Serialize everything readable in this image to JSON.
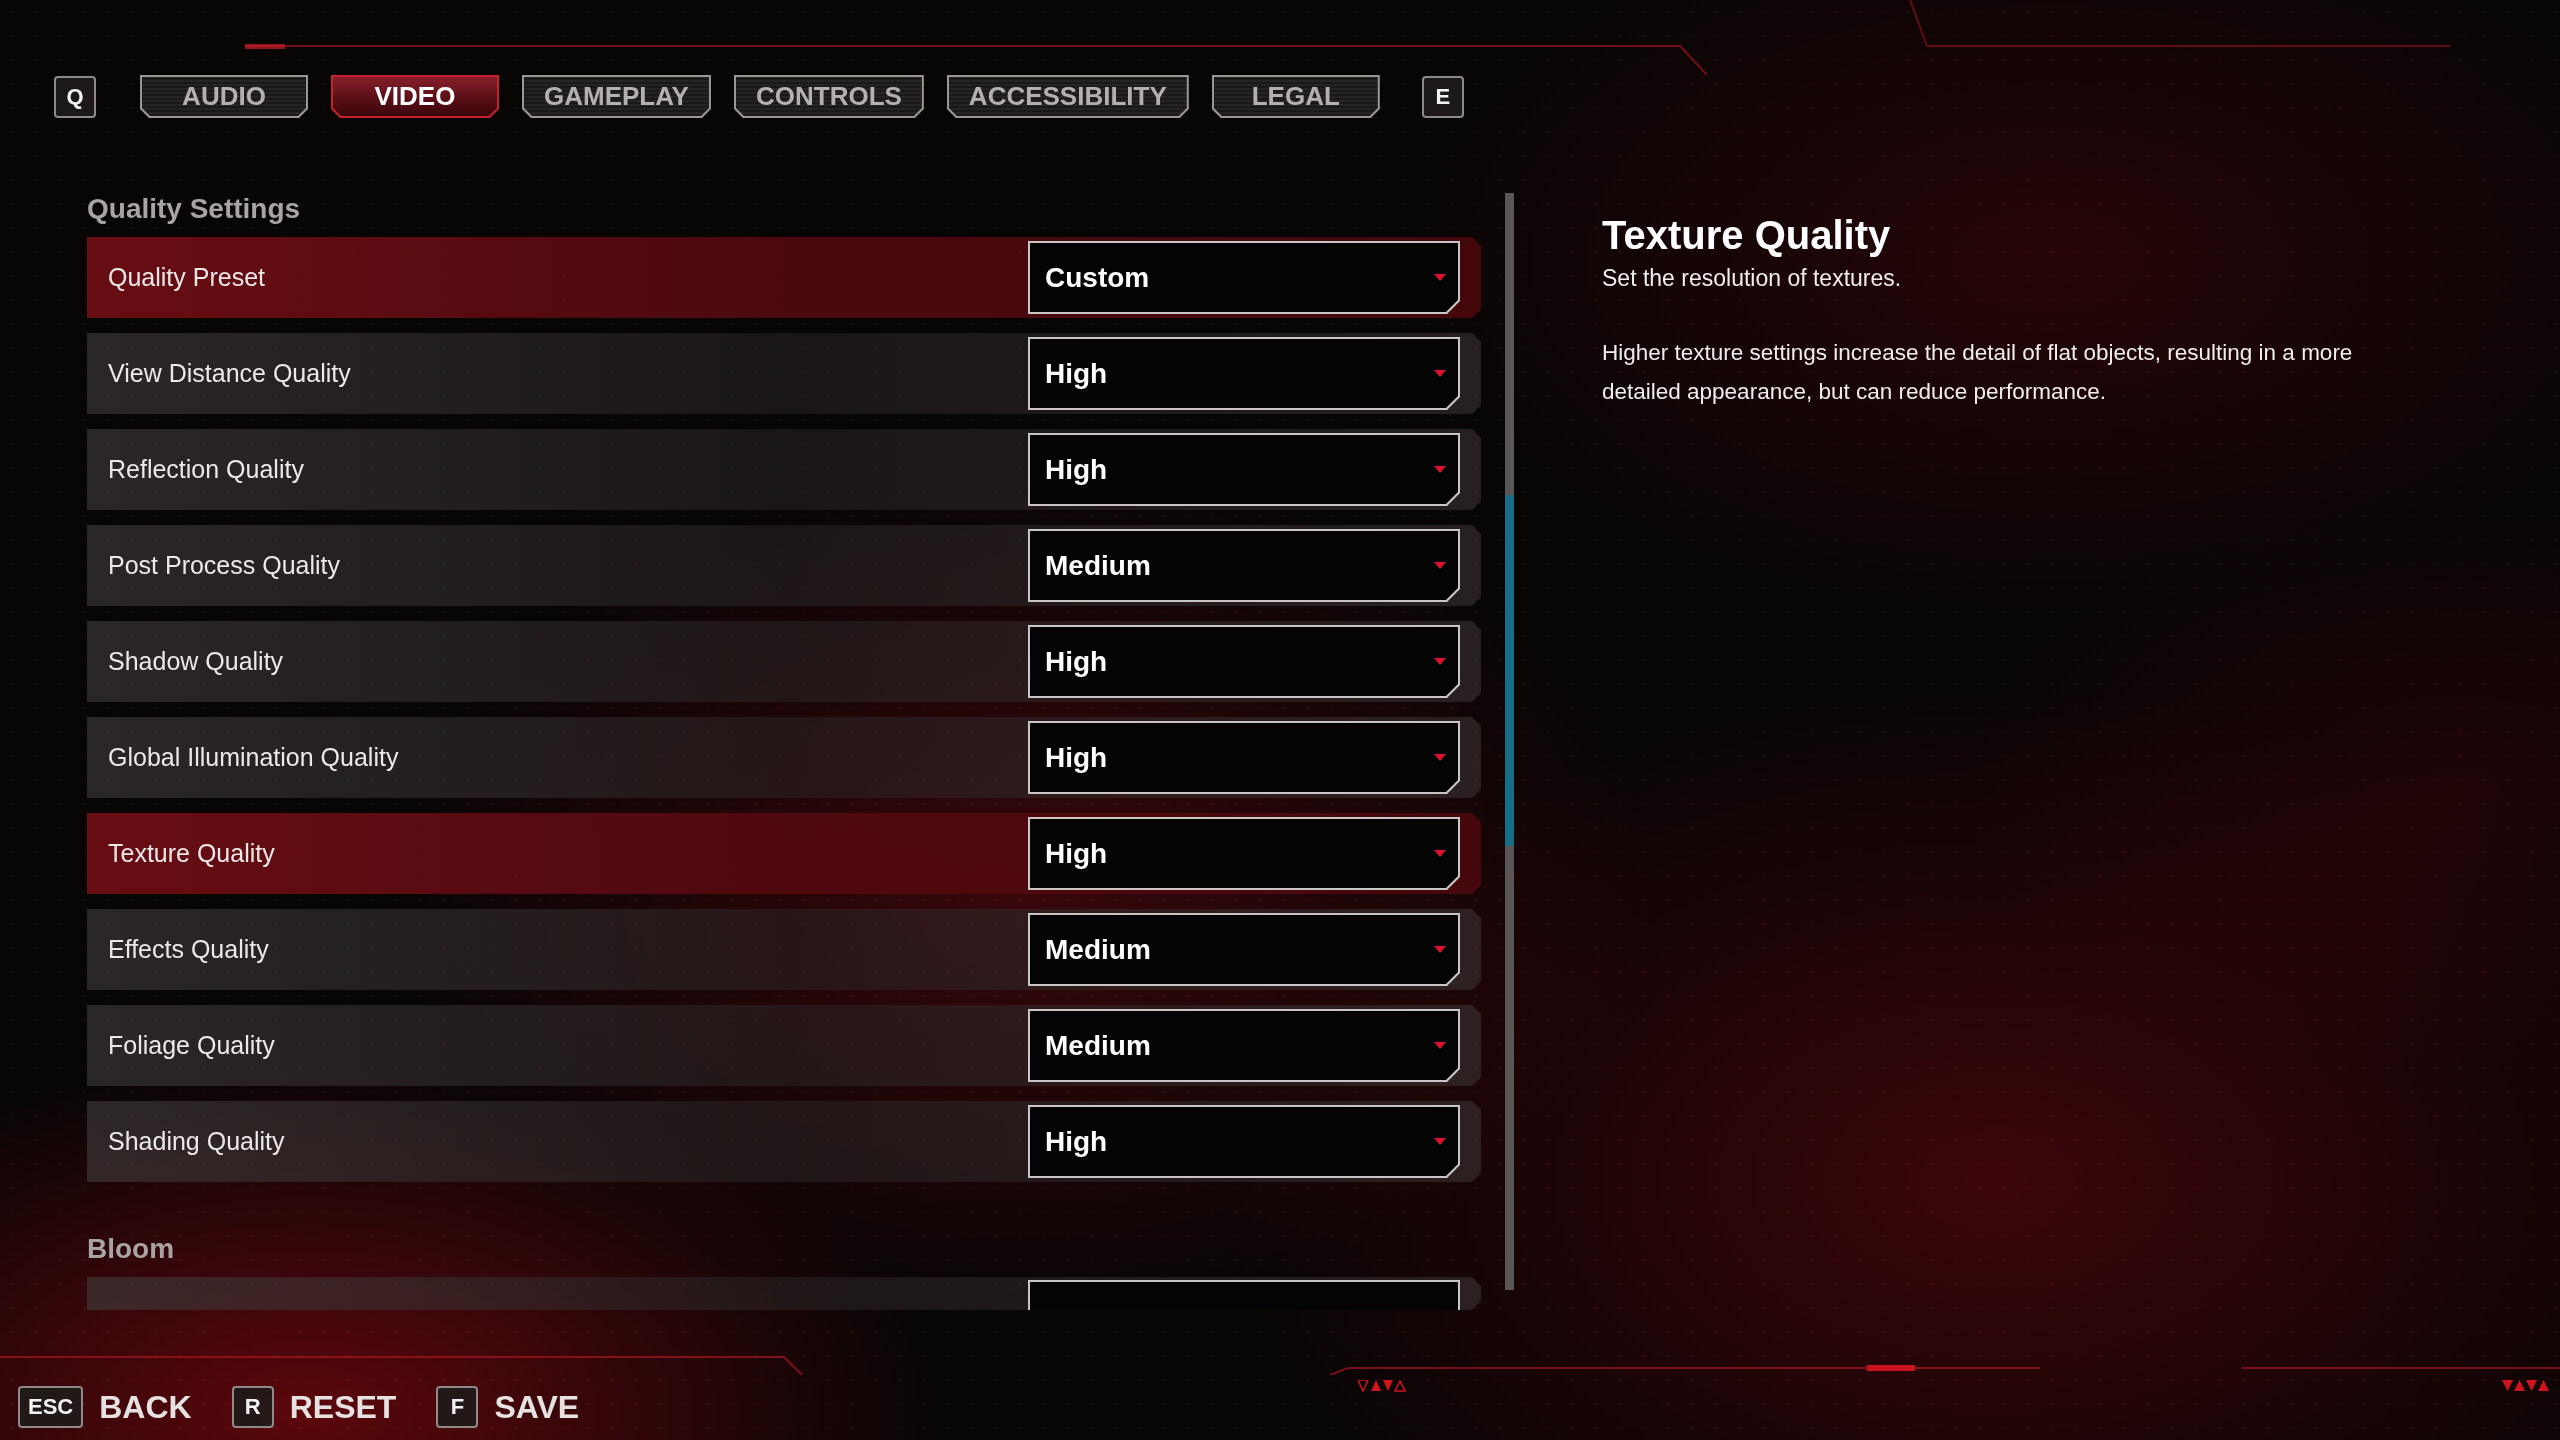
{
  "tabs": {
    "prev_key": "Q",
    "items": [
      {
        "label": "AUDIO",
        "selected": false
      },
      {
        "label": "VIDEO",
        "selected": true
      },
      {
        "label": "GAMEPLAY",
        "selected": false
      },
      {
        "label": "CONTROLS",
        "selected": false
      },
      {
        "label": "ACCESSIBILITY",
        "selected": false
      },
      {
        "label": "LEGAL",
        "selected": false
      }
    ],
    "next_key": "E"
  },
  "settings": {
    "sections": [
      {
        "title": "Quality Settings",
        "rows": [
          {
            "label": "Quality Preset",
            "value": "Custom",
            "selected": true
          },
          {
            "label": "View Distance Quality",
            "value": "High",
            "selected": false
          },
          {
            "label": "Reflection Quality",
            "value": "High",
            "selected": false
          },
          {
            "label": "Post Process Quality",
            "value": "Medium",
            "selected": false
          },
          {
            "label": "Shadow Quality",
            "value": "High",
            "selected": false
          },
          {
            "label": "Global Illumination Quality",
            "value": "High",
            "selected": false
          },
          {
            "label": "Texture Quality",
            "value": "High",
            "selected": true
          },
          {
            "label": "Effects Quality",
            "value": "Medium",
            "selected": false
          },
          {
            "label": "Foliage Quality",
            "value": "Medium",
            "selected": false
          },
          {
            "label": "Shading Quality",
            "value": "High",
            "selected": false
          }
        ]
      },
      {
        "title": "Bloom",
        "more_rows": true
      }
    ]
  },
  "detail": {
    "title": "Texture Quality",
    "subtitle": "Set the resolution of textures.",
    "description": "Higher texture settings increase the detail of flat objects, resulting in a more detailed appearance, but can reduce performance."
  },
  "actions": [
    {
      "key": "ESC",
      "label": "BACK"
    },
    {
      "key": "R",
      "label": "RESET"
    },
    {
      "key": "F",
      "label": "SAVE"
    }
  ]
}
